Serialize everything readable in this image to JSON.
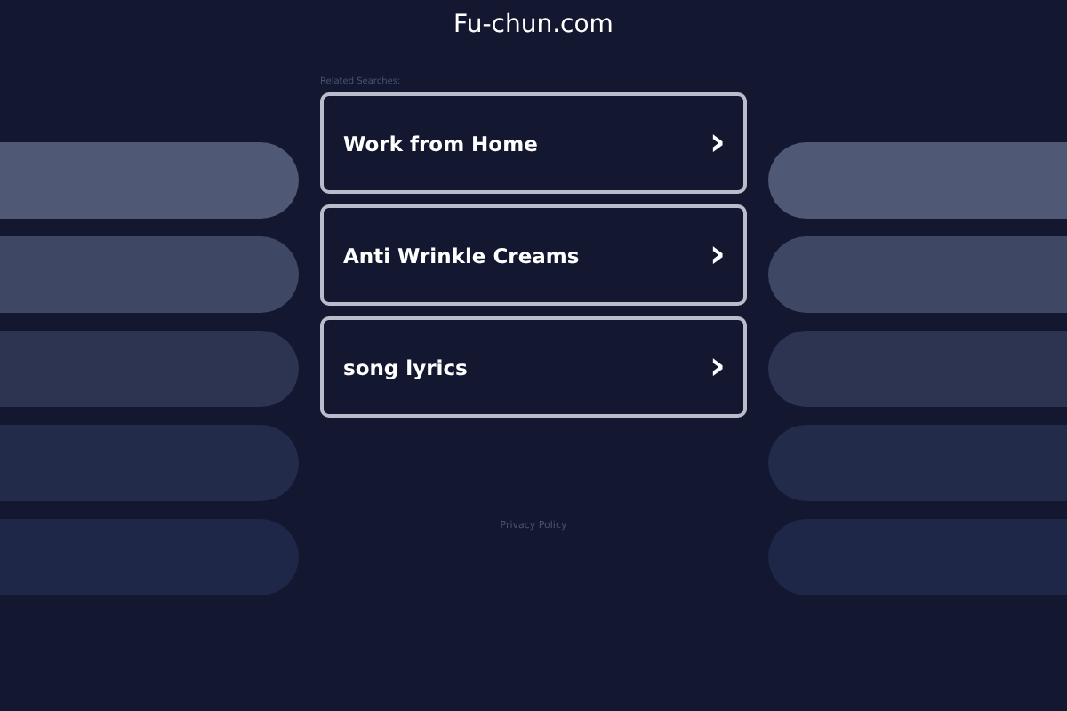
{
  "site_title": "Fu-chun.com",
  "related_heading": "Related Searches:",
  "searches": [
    {
      "label": "Work from Home",
      "icon": "›"
    },
    {
      "label": "Anti Wrinkle Creams",
      "icon": "›"
    },
    {
      "label": "song lyrics",
      "icon": "›"
    }
  ],
  "footer_link": "Privacy Policy"
}
